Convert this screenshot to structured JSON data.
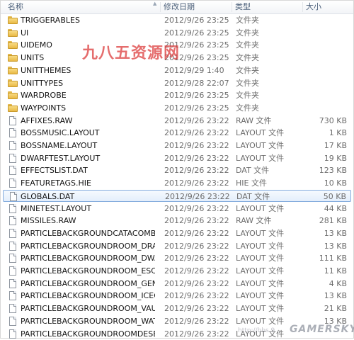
{
  "columns": {
    "name": "名称",
    "date": "修改日期",
    "type": "类型",
    "size": "大小"
  },
  "files": [
    {
      "name": "TRIGGERABLES",
      "date": "2012/9/26 23:25",
      "type": "文件夹",
      "size": "",
      "kind": "folder"
    },
    {
      "name": "UI",
      "date": "2012/9/26 23:25",
      "type": "文件夹",
      "size": "",
      "kind": "folder"
    },
    {
      "name": "UIDEMO",
      "date": "2012/9/26 23:25",
      "type": "文件夹",
      "size": "",
      "kind": "folder"
    },
    {
      "name": "UNITS",
      "date": "2012/9/26 23:25",
      "type": "文件夹",
      "size": "",
      "kind": "folder"
    },
    {
      "name": "UNITTHEMES",
      "date": "2012/9/29 1:40",
      "type": "文件夹",
      "size": "",
      "kind": "folder"
    },
    {
      "name": "UNITTYPES",
      "date": "2012/9/28 22:07",
      "type": "文件夹",
      "size": "",
      "kind": "folder"
    },
    {
      "name": "WARDROBE",
      "date": "2012/9/26 23:25",
      "type": "文件夹",
      "size": "",
      "kind": "folder"
    },
    {
      "name": "WAYPOINTS",
      "date": "2012/9/26 23:25",
      "type": "文件夹",
      "size": "",
      "kind": "folder"
    },
    {
      "name": "AFFIXES.RAW",
      "date": "2012/9/26 23:22",
      "type": "RAW 文件",
      "size": "730 KB",
      "kind": "file"
    },
    {
      "name": "BOSSMUSIC.LAYOUT",
      "date": "2012/9/26 23:22",
      "type": "LAYOUT 文件",
      "size": "1 KB",
      "kind": "file"
    },
    {
      "name": "BOSSNAME.LAYOUT",
      "date": "2012/9/26 23:22",
      "type": "LAYOUT 文件",
      "size": "17 KB",
      "kind": "file"
    },
    {
      "name": "DWARFTEST.LAYOUT",
      "date": "2012/9/26 23:22",
      "type": "LAYOUT 文件",
      "size": "19 KB",
      "kind": "file"
    },
    {
      "name": "EFFECTSLIST.DAT",
      "date": "2012/9/26 23:22",
      "type": "DAT 文件",
      "size": "123 KB",
      "kind": "file"
    },
    {
      "name": "FEATURETAGS.HIE",
      "date": "2012/9/26 23:22",
      "type": "HIE 文件",
      "size": "10 KB",
      "kind": "file"
    },
    {
      "name": "GLOBALS.DAT",
      "date": "2012/9/26 23:22",
      "type": "DAT 文件",
      "size": "50 KB",
      "kind": "file",
      "selected": true
    },
    {
      "name": "MINETEST.LAYOUT",
      "date": "2012/9/26 23:22",
      "type": "LAYOUT 文件",
      "size": "44 KB",
      "kind": "file"
    },
    {
      "name": "MISSILES.RAW",
      "date": "2012/9/26 23:22",
      "type": "RAW 文件",
      "size": "281 KB",
      "kind": "file"
    },
    {
      "name": "PARTICLEBACKGROUNDCATACOMB...",
      "date": "2012/9/26 23:22",
      "type": "LAYOUT 文件",
      "size": "13 KB",
      "kind": "file"
    },
    {
      "name": "PARTICLEBACKGROUNDROOM_DRA...",
      "date": "2012/9/26 23:22",
      "type": "LAYOUT 文件",
      "size": "13 KB",
      "kind": "file"
    },
    {
      "name": "PARTICLEBACKGROUNDROOM_DWA...",
      "date": "2012/9/26 23:22",
      "type": "LAYOUT 文件",
      "size": "111 KB",
      "kind": "file"
    },
    {
      "name": "PARTICLEBACKGROUNDROOM_ESCA...",
      "date": "2012/9/26 23:22",
      "type": "LAYOUT 文件",
      "size": "11 KB",
      "kind": "file"
    },
    {
      "name": "PARTICLEBACKGROUNDROOM_GEN...",
      "date": "2012/9/26 23:22",
      "type": "LAYOUT 文件",
      "size": "4 KB",
      "kind": "file"
    },
    {
      "name": "PARTICLEBACKGROUNDROOM_ICEC...",
      "date": "2012/9/26 23:22",
      "type": "LAYOUT 文件",
      "size": "13 KB",
      "kind": "file"
    },
    {
      "name": "PARTICLEBACKGROUNDROOM_VAU...",
      "date": "2012/9/26 23:22",
      "type": "LAYOUT 文件",
      "size": "21 KB",
      "kind": "file"
    },
    {
      "name": "PARTICLEBACKGROUNDROOM_WAT...",
      "date": "2012/9/26 23:22",
      "type": "LAYOUT 文件",
      "size": "13 KB",
      "kind": "file"
    },
    {
      "name": "PARTICLEBACKGROUNDROOMDESE...",
      "date": "2012/9/26 23:22",
      "type": "LAYOUT 文件",
      "size": "",
      "kind": "file"
    }
  ],
  "watermarks": {
    "top": "九八五资源网",
    "bottom": "GAMERSKY",
    "url": "http://bbs.9"
  }
}
